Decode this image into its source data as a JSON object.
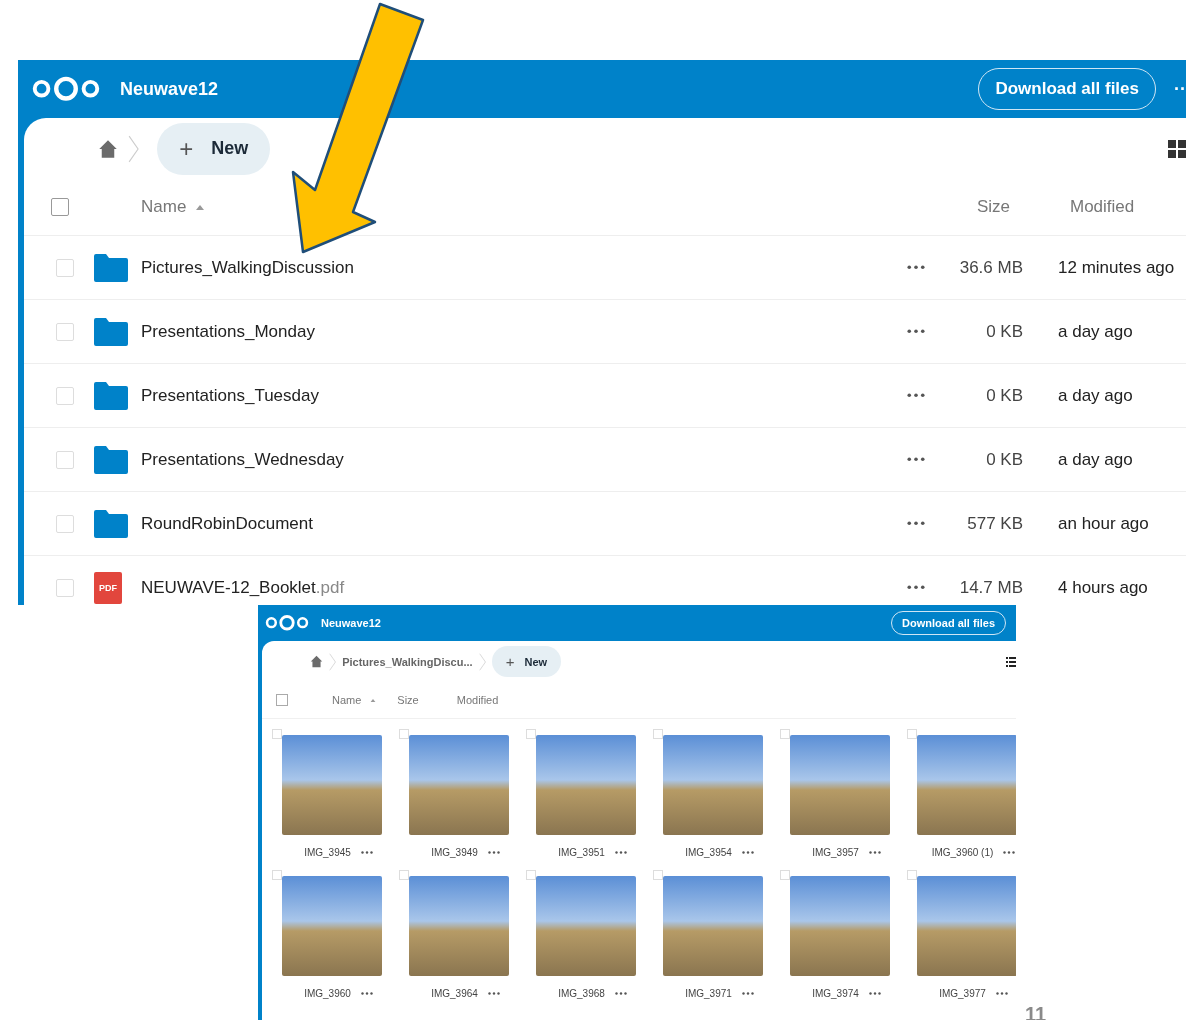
{
  "main_window": {
    "brand": "Neuwave12",
    "download_button": "Download all files",
    "more_icon_text": "··",
    "new_button": {
      "icon": "+",
      "label": "New"
    },
    "columns": {
      "name": "Name",
      "size": "Size",
      "modified": "Modified"
    },
    "all_selected": false,
    "rows": [
      {
        "kind": "folder",
        "name": "Pictures_WalkingDiscussion",
        "size": "36.6 MB",
        "modified": "12 minutes ago",
        "selected": false
      },
      {
        "kind": "folder",
        "name": "Presentations_Monday",
        "size": "0 KB",
        "modified": "a day ago",
        "selected": false
      },
      {
        "kind": "folder",
        "name": "Presentations_Tuesday",
        "size": "0 KB",
        "modified": "a day ago",
        "selected": false
      },
      {
        "kind": "folder",
        "name": "Presentations_Wednesday",
        "size": "0 KB",
        "modified": "a day ago",
        "selected": false
      },
      {
        "kind": "folder",
        "name": "RoundRobinDocument",
        "size": "577 KB",
        "modified": "an hour ago",
        "selected": false
      },
      {
        "kind": "pdf",
        "badge": "PDF",
        "name": "NEUWAVE-12_Booklet",
        "extension": ".pdf",
        "size": "14.7 MB",
        "modified": "4 hours ago",
        "selected": false
      }
    ]
  },
  "folder_window": {
    "brand": "Neuwave12",
    "download_button": "Download all files",
    "breadcrumb": "Pictures_WalkingDiscu...",
    "new_button": {
      "icon": "+",
      "label": "New"
    },
    "columns": {
      "name": "Name",
      "size": "Size",
      "modified": "Modified"
    },
    "all_selected": false,
    "photos": [
      {
        "name": "IMG_3945",
        "selected": false
      },
      {
        "name": "IMG_3949",
        "selected": false
      },
      {
        "name": "IMG_3951",
        "selected": false
      },
      {
        "name": "IMG_3954",
        "selected": false
      },
      {
        "name": "IMG_3957",
        "selected": false
      },
      {
        "name": "IMG_3960 (1)",
        "selected": false
      },
      {
        "name": "IMG_3960",
        "selected": false
      },
      {
        "name": "IMG_3964",
        "selected": false
      },
      {
        "name": "IMG_3968",
        "selected": false
      },
      {
        "name": "IMG_3971",
        "selected": false
      },
      {
        "name": "IMG_3974",
        "selected": false
      },
      {
        "name": "IMG_3977",
        "selected": false
      }
    ]
  },
  "slide_number": "11"
}
